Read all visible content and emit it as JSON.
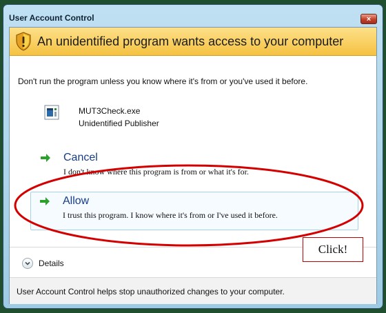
{
  "window": {
    "title": "User Account Control",
    "close_glyph": "×"
  },
  "banner": {
    "text": "An unidentified program wants access to your computer",
    "icon": "shield-icon"
  },
  "warning_text": "Don't run the program unless you know where it's from or you've used it before.",
  "program": {
    "name": "MUT3Check.exe",
    "publisher": "Unidentified Publisher",
    "icon": "program-icon"
  },
  "options": {
    "cancel": {
      "title": "Cancel",
      "description": "I don't know where this program is from or what it's for."
    },
    "allow": {
      "title": "Allow",
      "description": "I trust this program. I know where it's from or I've used it before."
    }
  },
  "details": {
    "label": "Details"
  },
  "footer": {
    "text": "User Account Control helps stop unauthorized changes to your computer."
  },
  "annotation": {
    "callout_text": "Click!",
    "color": "#d40000"
  },
  "colors": {
    "banner": "#f5c241",
    "arrow": "#2ba02b",
    "link": "#163c88"
  }
}
